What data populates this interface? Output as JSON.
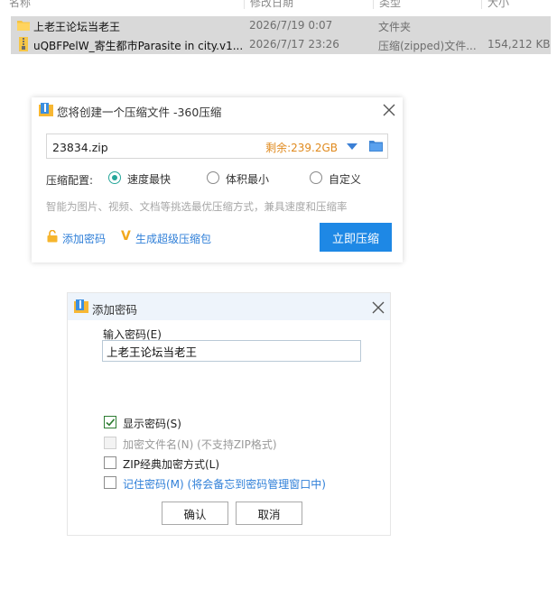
{
  "file_list": {
    "rows": [
      {
        "name": "上老王论坛当老王",
        "date": "2026/7/19 0:07",
        "type": "文件夹",
        "size": "",
        "icon": "folder-icon"
      },
      {
        "name": "uQBFPelW_寄生都市Parasite in city.v1...",
        "date": "2026/7/17 23:26",
        "type": "压缩(zipped)文件...",
        "size": "154,212 KB",
        "icon": "zip-file-icon"
      }
    ]
  },
  "compress_dialog": {
    "title": "您将创建一个压缩文件 -360压缩",
    "filename": "23834.zip",
    "free_space": "剩余:239.2GB",
    "config_label": "压缩配置:",
    "options": [
      {
        "label": "速度最快",
        "selected": true
      },
      {
        "label": "体积最小",
        "selected": false
      },
      {
        "label": "自定义",
        "selected": false
      }
    ],
    "hint": "智能为图片、视频、文档等挑选最优压缩方式，兼具速度和压缩率",
    "add_password_label": "添加密码",
    "super_package_label": "生成超级压缩包",
    "compress_button": "立即压缩",
    "accent_color": "#1e88e5"
  },
  "password_dialog": {
    "title": "添加密码",
    "input_label": "输入密码(E)",
    "password_value": "上老王论坛当老王",
    "checkboxes": [
      {
        "label": "显示密码(S)",
        "checked": true,
        "disabled": false
      },
      {
        "label": "加密文件名(N) (不支持ZIP格式)",
        "checked": false,
        "disabled": true
      },
      {
        "label": "ZIP经典加密方式(L)",
        "checked": false,
        "disabled": false
      },
      {
        "label": "记住密码(M) (将会备忘到密码管理窗口中)",
        "checked": false,
        "disabled": false
      }
    ],
    "ok_button": "确认",
    "cancel_button": "取消"
  }
}
